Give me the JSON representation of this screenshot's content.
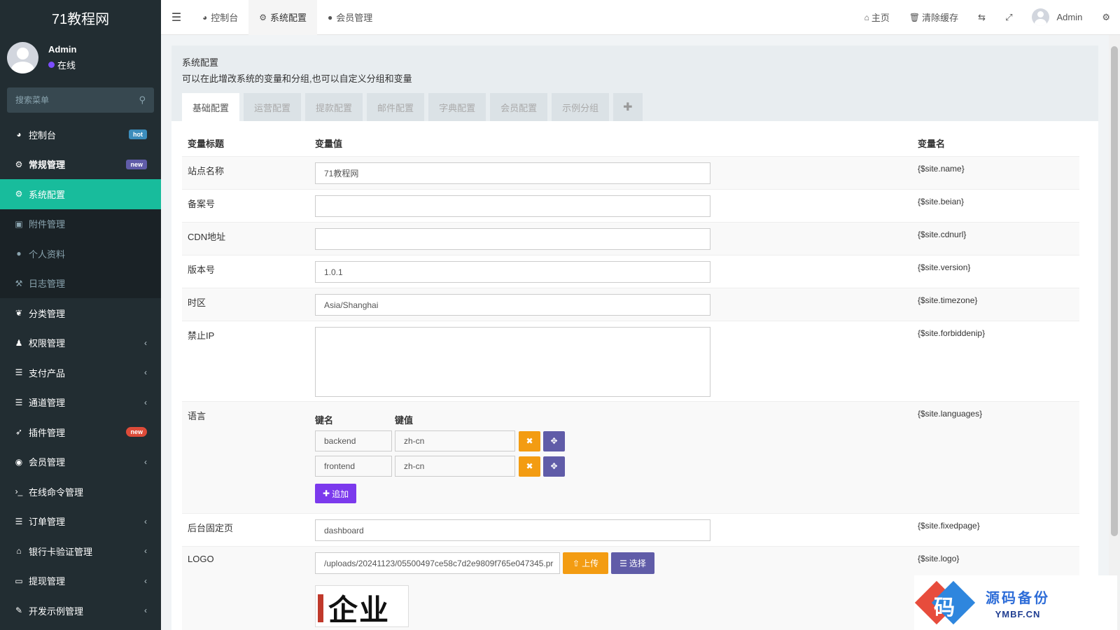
{
  "brand": "71教程网",
  "user": {
    "name": "Admin",
    "status": "在线"
  },
  "search": {
    "placeholder": "搜索菜单"
  },
  "menu": [
    {
      "icon": "dashboard-icon",
      "glyph": "◕",
      "label": "控制台",
      "badge": "hot",
      "badge_type": "hot",
      "state": "",
      "chevron": false
    },
    {
      "icon": "cogs-icon",
      "glyph": "⚙",
      "label": "常规管理",
      "badge": "new",
      "badge_type": "new",
      "state": "bold",
      "chevron": false
    },
    {
      "icon": "gear-icon",
      "glyph": "⚙",
      "label": "系统配置",
      "badge": "",
      "badge_type": "",
      "state": "active",
      "chevron": false
    },
    {
      "icon": "file-image-icon",
      "glyph": "▣",
      "label": "附件管理",
      "badge": "",
      "badge_type": "",
      "state": "sub",
      "chevron": false
    },
    {
      "icon": "user-icon",
      "glyph": "●",
      "label": "个人资料",
      "badge": "",
      "badge_type": "",
      "state": "sub",
      "chevron": false
    },
    {
      "icon": "log-icon",
      "glyph": "⚒",
      "label": "日志管理",
      "badge": "",
      "badge_type": "",
      "state": "sub",
      "chevron": false
    },
    {
      "icon": "leaf-icon",
      "glyph": "❦",
      "label": "分类管理",
      "badge": "",
      "badge_type": "",
      "state": "",
      "chevron": false
    },
    {
      "icon": "group-icon",
      "glyph": "♟",
      "label": "权限管理",
      "badge": "",
      "badge_type": "",
      "state": "",
      "chevron": true
    },
    {
      "icon": "list-icon",
      "glyph": "☰",
      "label": "支付产品",
      "badge": "",
      "badge_type": "",
      "state": "",
      "chevron": true
    },
    {
      "icon": "list-icon",
      "glyph": "☰",
      "label": "通道管理",
      "badge": "",
      "badge_type": "",
      "state": "",
      "chevron": true
    },
    {
      "icon": "rocket-icon",
      "glyph": "➶",
      "label": "插件管理",
      "badge": "new",
      "badge_type": "new-red",
      "state": "",
      "chevron": false
    },
    {
      "icon": "user-circle-icon",
      "glyph": "◉",
      "label": "会员管理",
      "badge": "",
      "badge_type": "",
      "state": "",
      "chevron": true
    },
    {
      "icon": "terminal-icon",
      "glyph": "›_",
      "label": "在线命令管理",
      "badge": "",
      "badge_type": "",
      "state": "",
      "chevron": false
    },
    {
      "icon": "list-icon",
      "glyph": "☰",
      "label": "订单管理",
      "badge": "",
      "badge_type": "",
      "state": "",
      "chevron": true
    },
    {
      "icon": "bank-icon",
      "glyph": "⌂",
      "label": "银行卡验证管理",
      "badge": "",
      "badge_type": "",
      "state": "",
      "chevron": true
    },
    {
      "icon": "credit-card-icon",
      "glyph": "▭",
      "label": "提现管理",
      "badge": "",
      "badge_type": "",
      "state": "",
      "chevron": true
    },
    {
      "icon": "magic-icon",
      "glyph": "✎",
      "label": "开发示例管理",
      "badge": "",
      "badge_type": "",
      "state": "",
      "chevron": true
    }
  ],
  "topnav": {
    "tabs": [
      {
        "icon": "dashboard-icon",
        "glyph": "◕",
        "label": "控制台",
        "active": false
      },
      {
        "icon": "gear-icon",
        "glyph": "⚙",
        "label": "系统配置",
        "active": true
      },
      {
        "icon": "user-icon",
        "glyph": "●",
        "label": "会员管理",
        "active": false
      }
    ],
    "home": "主页",
    "clear_cache": "清除缓存",
    "admin": "Admin"
  },
  "panel": {
    "title": "系统配置",
    "description": "可以在此增改系统的变量和分组,也可以自定义分组和变量",
    "tabs": [
      "基础配置",
      "运营配置",
      "提款配置",
      "邮件配置",
      "字典配置",
      "会员配置",
      "示例分组"
    ]
  },
  "table": {
    "headers": {
      "title": "变量标题",
      "value": "变量值",
      "name": "变量名"
    },
    "rows": {
      "site_name": {
        "title": "站点名称",
        "value": "71教程网",
        "var": "{$site.name}"
      },
      "beian": {
        "title": "备案号",
        "value": "",
        "var": "{$site.beian}"
      },
      "cdn": {
        "title": "CDN地址",
        "value": "",
        "var": "{$site.cdnurl}"
      },
      "version": {
        "title": "版本号",
        "value": "1.0.1",
        "var": "{$site.version}"
      },
      "timezone": {
        "title": "时区",
        "value": "Asia/Shanghai",
        "var": "{$site.timezone}"
      },
      "forbiddenip": {
        "title": "禁止IP",
        "value": "",
        "var": "{$site.forbiddenip}"
      },
      "languages": {
        "title": "语言",
        "var": "{$site.languages}",
        "key_header": "键名",
        "value_header": "键值",
        "pairs": [
          {
            "key": "backend",
            "value": "zh-cn"
          },
          {
            "key": "frontend",
            "value": "zh-cn"
          }
        ],
        "add_label": "追加"
      },
      "fixedpage": {
        "title": "后台固定页",
        "value": "dashboard",
        "var": "{$site.fixedpage}"
      },
      "logo": {
        "title": "LOGO",
        "value": "/uploads/20241123/05500497ce58c7d2e9809f765e047345.pr",
        "var": "{$site.logo}",
        "upload_label": "上传",
        "select_label": "选择",
        "preview_text": "企业"
      }
    }
  },
  "watermark": {
    "cn": "源码备份",
    "en": "YMBF.CN",
    "emblem": "码"
  },
  "colors": {
    "sidebar": "#222d32",
    "active": "#18bc9c",
    "warning": "#f39c12",
    "purple": "#605ca8",
    "violet": "#7c3aed"
  }
}
